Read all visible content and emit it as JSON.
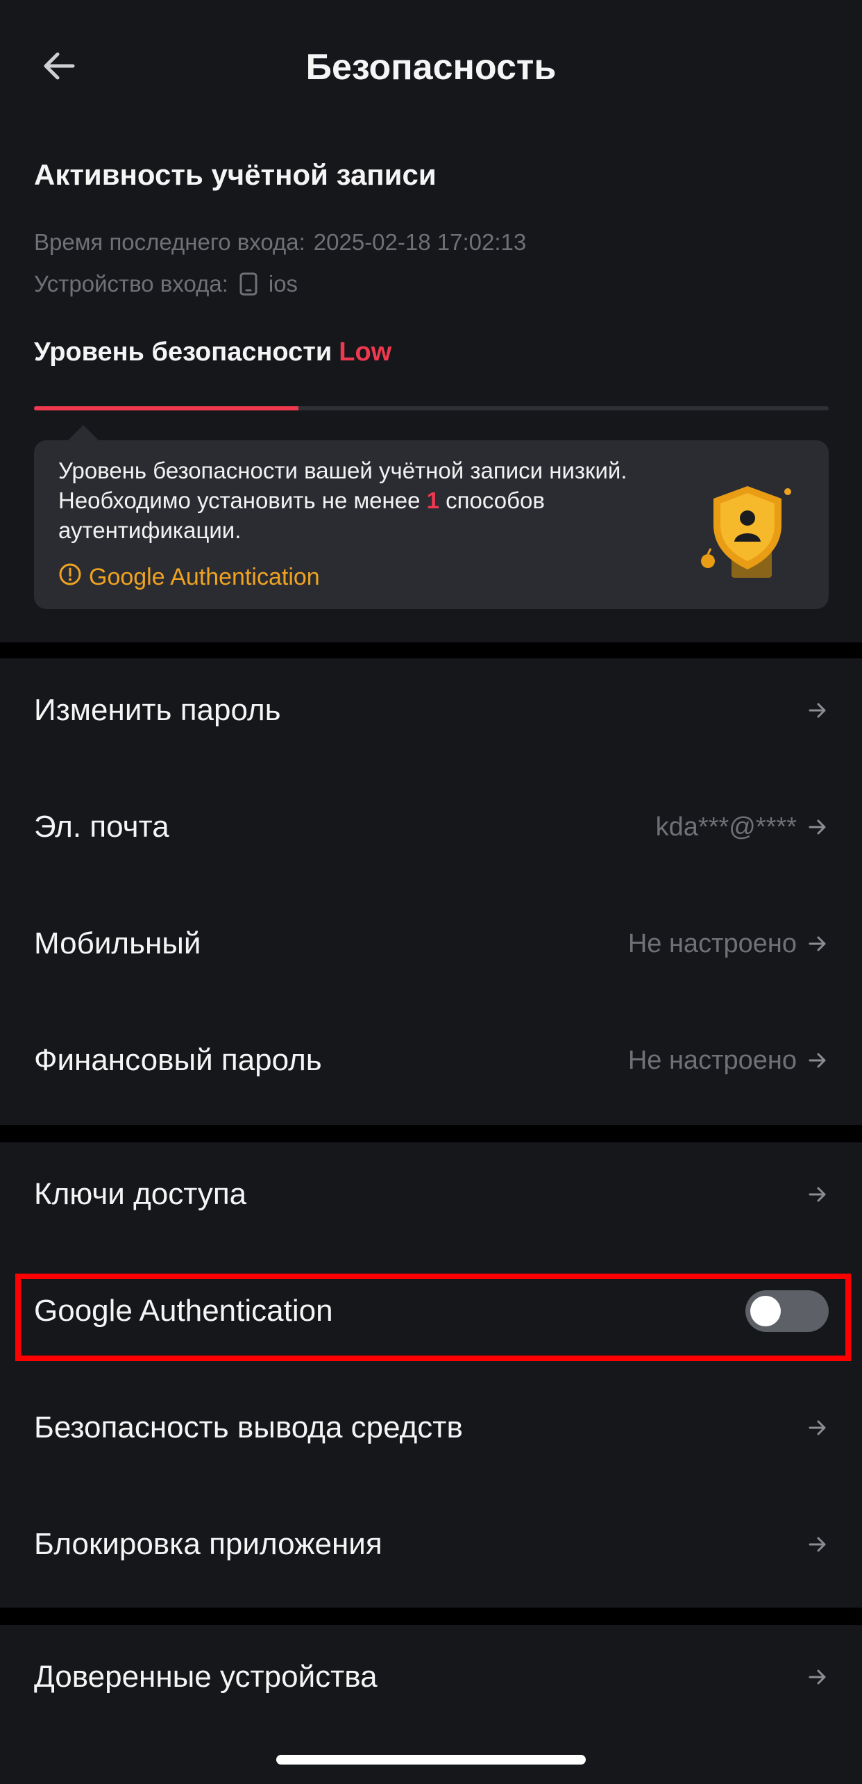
{
  "header": {
    "title": "Безопасность",
    "back_icon": "arrow-left-icon"
  },
  "activity": {
    "title": "Активность учётной записи",
    "last_login_label": "Время последнего входа:",
    "last_login_value": "2025-02-18 17:02:13",
    "device_label": "Устройство входа:",
    "device_value": "ios",
    "device_icon": "phone-icon"
  },
  "security": {
    "level_label": "Уровень безопасности",
    "level_value": "Low",
    "level_fraction": 0.333,
    "notice_text_1": "Уровень безопасности вашей учётной записи низкий. Необходимо установить не менее",
    "notice_required": "1",
    "notice_text_2": "способов аутентификации.",
    "suggestion": "Google Authentication",
    "suggestion_icon": "warning-circle-icon"
  },
  "groups": {
    "account": [
      {
        "label": "Изменить пароль",
        "value": ""
      },
      {
        "label": "Эл. почта",
        "value": "kda***@****"
      },
      {
        "label": "Мобильный",
        "value": "Не настроено"
      },
      {
        "label": "Финансовый пароль",
        "value": "Не настроено"
      }
    ],
    "protection": [
      {
        "label": "Ключи доступа",
        "value": ""
      },
      {
        "label": "Google Authentication",
        "toggle": false
      },
      {
        "label": "Безопасность вывода средств",
        "value": ""
      },
      {
        "label": "Блокировка приложения",
        "value": ""
      }
    ],
    "devices": [
      {
        "label": "Доверенные устройства",
        "value": ""
      }
    ]
  },
  "colors": {
    "background": "#000000",
    "surface": "#15171b",
    "card": "#2a2c32",
    "danger": "#f0394f",
    "warning": "#f0a321",
    "muted": "#6f7177",
    "toggle_off": "#5d6066",
    "highlight": "#ff0000"
  }
}
